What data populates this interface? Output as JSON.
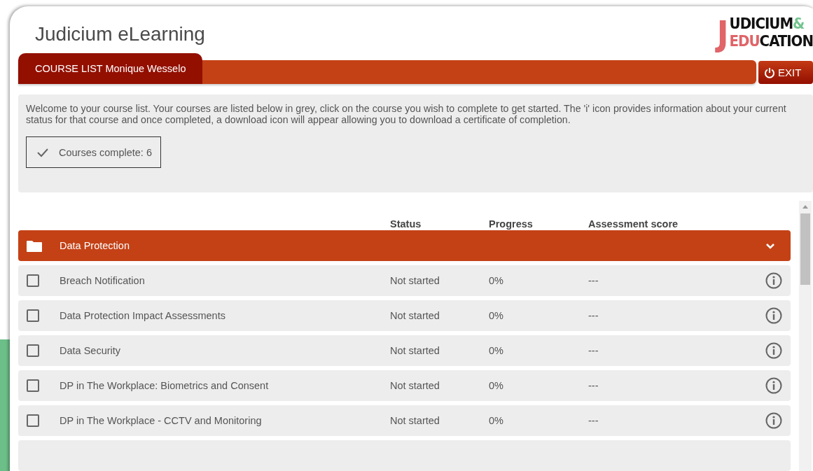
{
  "header": {
    "title": "Judicium eLearning",
    "logo": {
      "initial": "J",
      "top": "UDICIUM",
      "amp": "&",
      "accent": "EDU",
      "bottom": "CATION"
    }
  },
  "tabs": [
    {
      "label": "COURSE LIST Monique Wesselo",
      "selected": true
    }
  ],
  "exit_button": {
    "label": "EXIT"
  },
  "intro": {
    "text": "Welcome to your course list. Your courses are listed below in grey, click on the course you wish to complete to get started. The 'i' icon provides information about your current status for that course and once completed, a download icon will appear allowing you to download a certificate of completion.",
    "courses_complete": "Courses complete: 6"
  },
  "table": {
    "columns": [
      "Status",
      "Progress",
      "Assessment score"
    ],
    "groups": [
      {
        "name": "Data Protection",
        "expanded": true,
        "rows": [
          {
            "course": "Breach Notification",
            "status": "Not started",
            "progress": "0%",
            "score": "---",
            "checked": false
          },
          {
            "course": "Data Protection Impact Assessments",
            "status": "Not started",
            "progress": "0%",
            "score": "---",
            "checked": false
          },
          {
            "course": "Data Security",
            "status": "Not started",
            "progress": "0%",
            "score": "---",
            "checked": false
          },
          {
            "course": "DP in The Workplace: Biometrics and Consent",
            "status": "Not started",
            "progress": "0%",
            "score": "---",
            "checked": false
          },
          {
            "course": "DP in The Workplace - CCTV and Monitoring",
            "status": "Not started",
            "progress": "0%",
            "score": "---",
            "checked": false
          }
        ]
      }
    ]
  }
}
